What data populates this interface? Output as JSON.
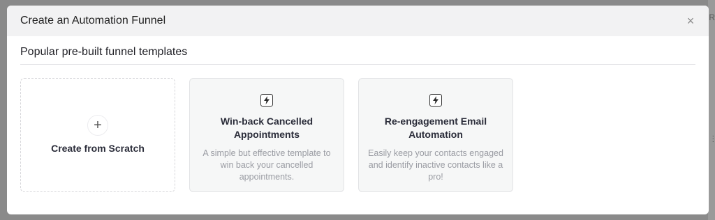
{
  "modal": {
    "title": "Create an Automation Funnel",
    "close_glyph": "×"
  },
  "section": {
    "title": "Popular pre-built funnel templates"
  },
  "scratch_card": {
    "plus_glyph": "+",
    "label": "Create from Scratch"
  },
  "templates": [
    {
      "icon": "lightning-bolt-icon",
      "title": "Win-back Cancelled Appointments",
      "description": "A simple but effective template to win back your cancelled appointments."
    },
    {
      "icon": "lightning-bolt-icon",
      "title": "Re-engagement Email Automation",
      "description": "Easily keep your contacts engaged and identify inactive contacts like a pro!"
    }
  ],
  "backdrop": {
    "edge_glyph": "R"
  },
  "colors": {
    "backdrop": "#8a8a8a",
    "header_bg": "#f2f2f3",
    "template_card_bg": "#f6f7f7",
    "title_text": "#2b2d3a",
    "muted_text": "#9a9ca3"
  }
}
